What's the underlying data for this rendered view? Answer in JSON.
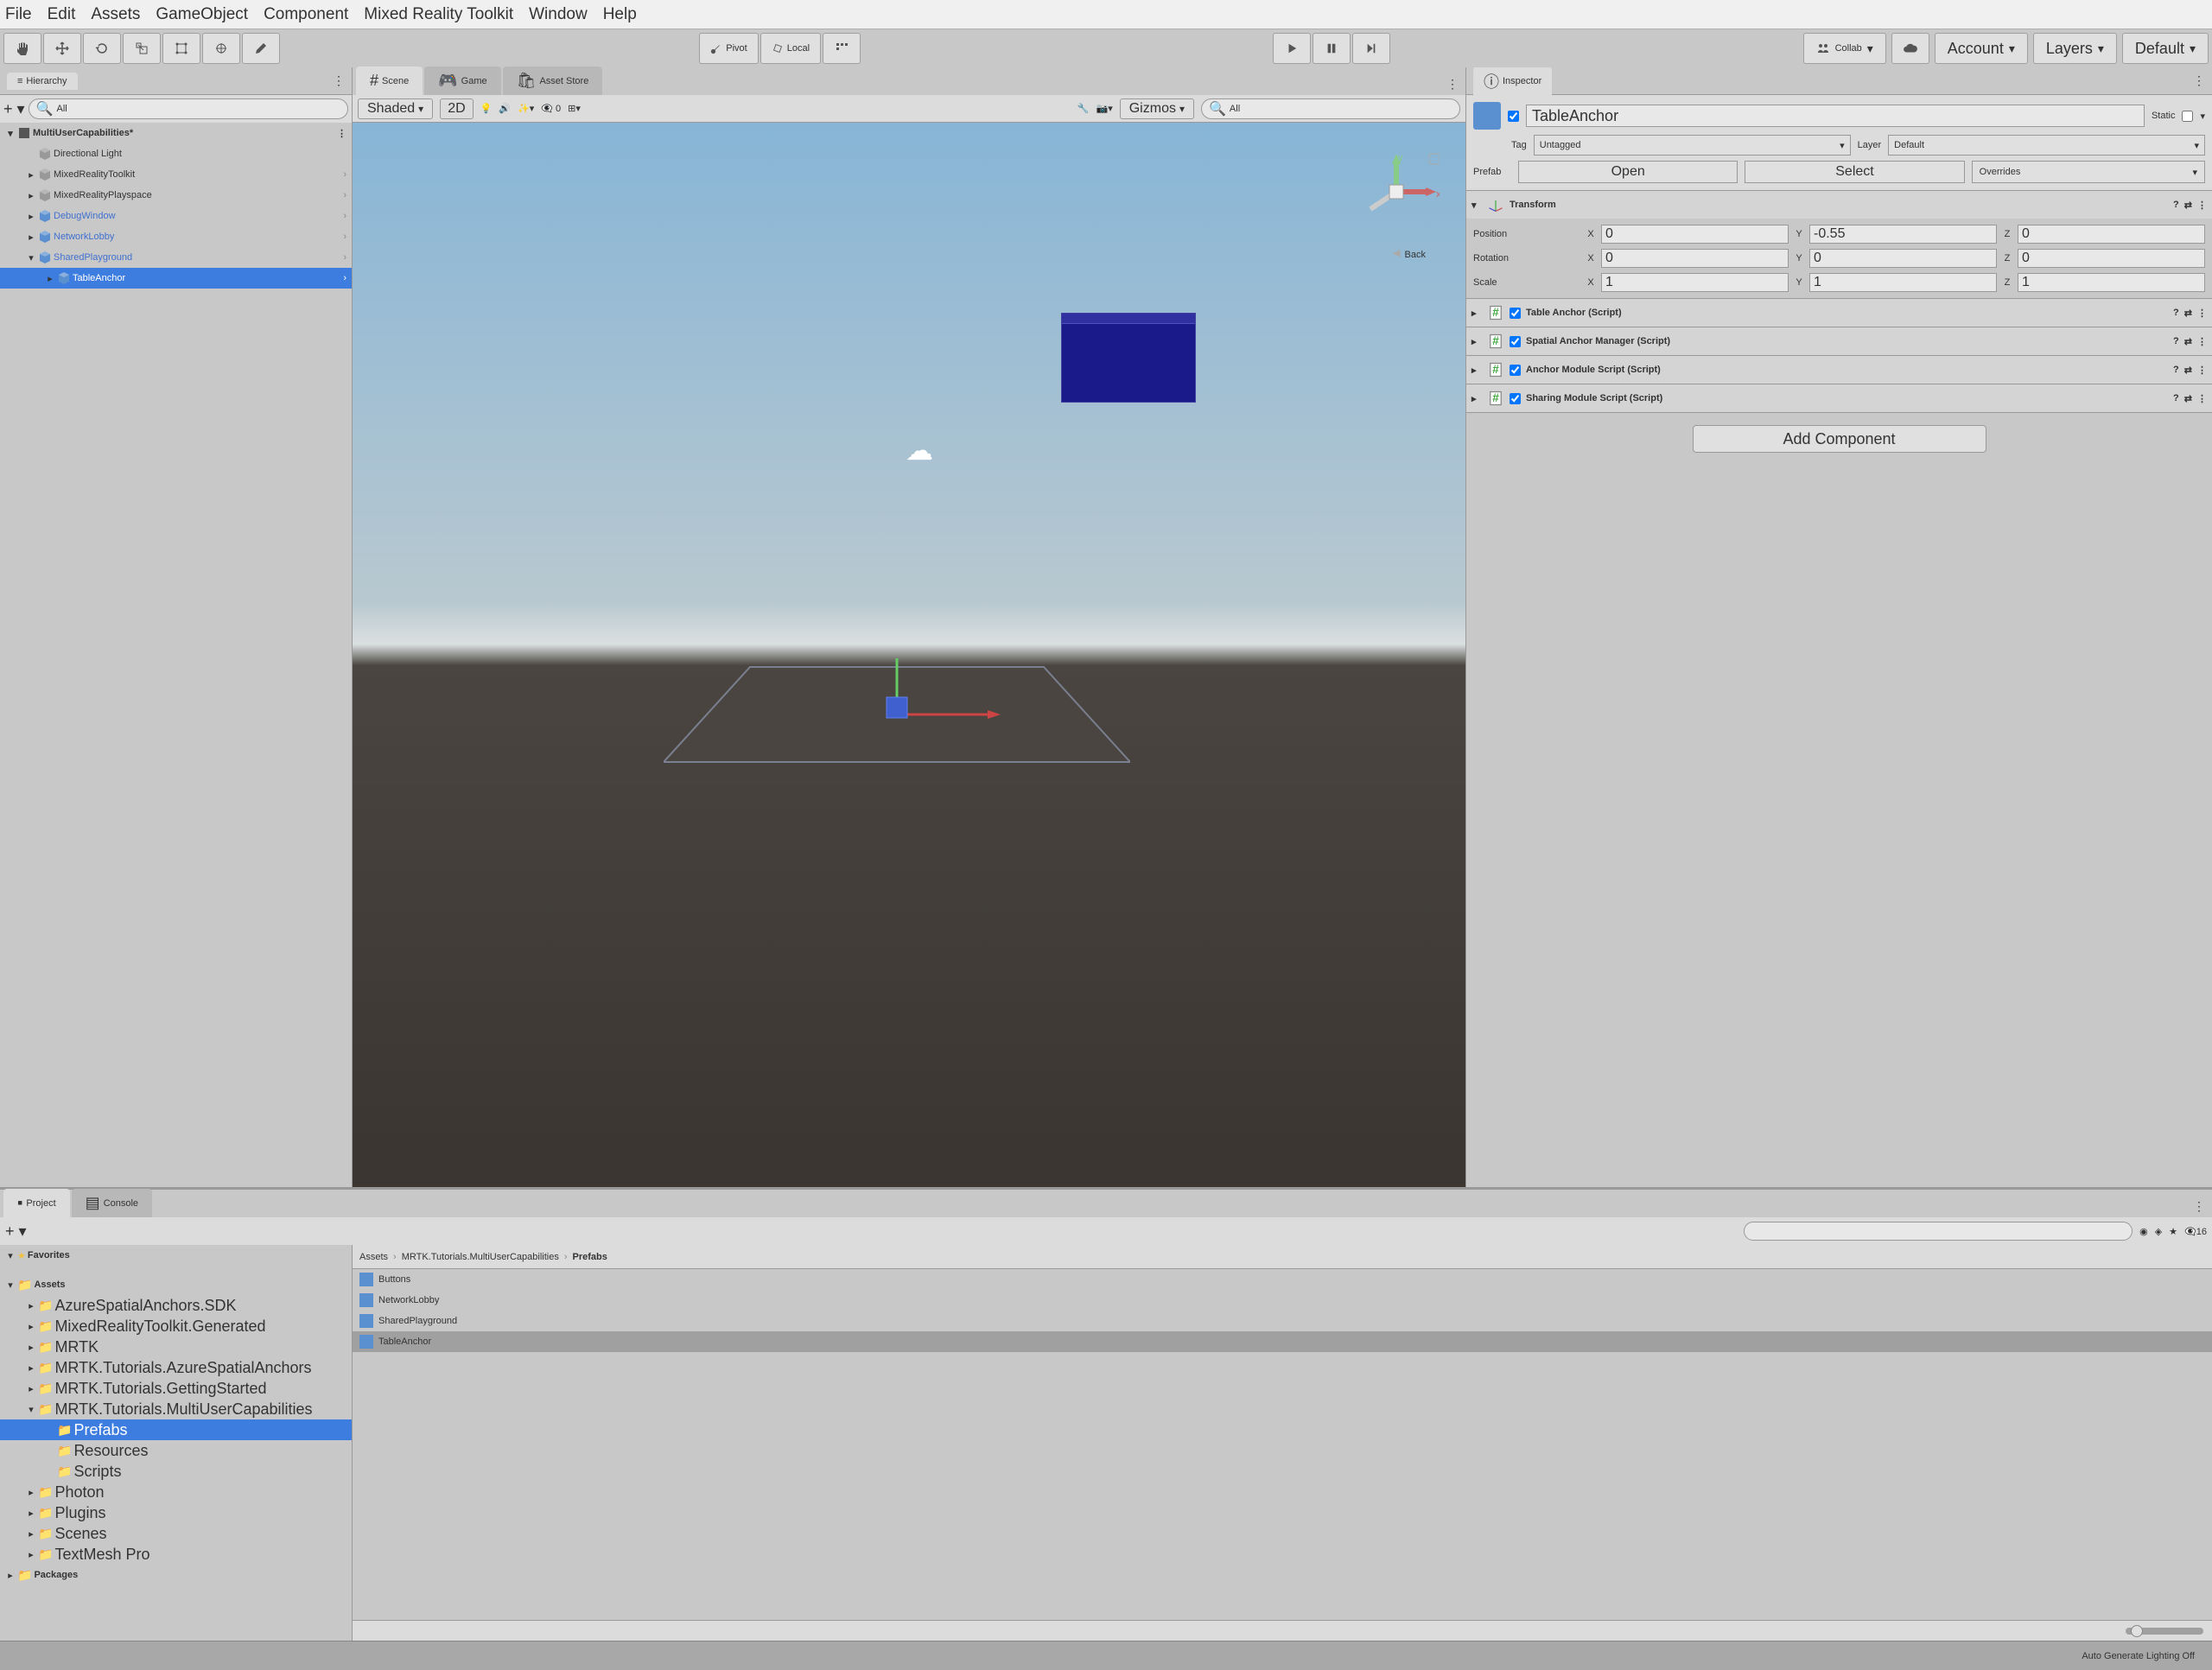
{
  "menubar": [
    "File",
    "Edit",
    "Assets",
    "GameObject",
    "Component",
    "Mixed Reality Toolkit",
    "Window",
    "Help"
  ],
  "toolbar": {
    "pivot": "Pivot",
    "local": "Local",
    "collab": "Collab",
    "account": "Account",
    "layers": "Layers",
    "layout": "Default"
  },
  "hierarchy": {
    "title": "Hierarchy",
    "search_placeholder": "All",
    "root": "MultiUserCapabilities*",
    "items": [
      {
        "name": "Directional Light",
        "depth": 1,
        "type": "light",
        "fold": ""
      },
      {
        "name": "MixedRealityToolkit",
        "depth": 1,
        "type": "prefab",
        "fold": "▸"
      },
      {
        "name": "MixedRealityPlayspace",
        "depth": 1,
        "type": "prefab",
        "fold": "▸"
      },
      {
        "name": "DebugWindow",
        "depth": 1,
        "type": "prefab",
        "fold": "▸",
        "blue": true
      },
      {
        "name": "NetworkLobby",
        "depth": 1,
        "type": "prefab",
        "fold": "▸",
        "blue": true
      },
      {
        "name": "SharedPlayground",
        "depth": 1,
        "type": "prefab",
        "fold": "▾",
        "blue": true
      },
      {
        "name": "TableAnchor",
        "depth": 2,
        "type": "prefab",
        "fold": "▸",
        "blue": true,
        "selected": true
      }
    ]
  },
  "center": {
    "tabs": [
      "Scene",
      "Game",
      "Asset Store"
    ],
    "shaded": "Shaded",
    "mode2d": "2D",
    "gizmos": "Gizmos",
    "zero": "0",
    "back": "Back",
    "search_placeholder": "All"
  },
  "inspector": {
    "title": "Inspector",
    "name": "TableAnchor",
    "static": "Static",
    "tag_label": "Tag",
    "tag_value": "Untagged",
    "layer_label": "Layer",
    "layer_value": "Default",
    "prefab_label": "Prefab",
    "open": "Open",
    "select": "Select",
    "overrides": "Overrides",
    "transform": {
      "title": "Transform",
      "rows": [
        {
          "label": "Position",
          "x": "0",
          "y": "-0.55",
          "z": "0"
        },
        {
          "label": "Rotation",
          "x": "0",
          "y": "0",
          "z": "0"
        },
        {
          "label": "Scale",
          "x": "1",
          "y": "1",
          "z": "1"
        }
      ]
    },
    "scripts": [
      "Table Anchor (Script)",
      "Spatial Anchor Manager (Script)",
      "Anchor Module Script (Script)",
      "Sharing Module Script (Script)"
    ],
    "add_component": "Add Component"
  },
  "project": {
    "title": "Project",
    "console": "Console",
    "count": "16",
    "favorites": "Favorites",
    "assets": "Assets",
    "packages": "Packages",
    "tree": [
      {
        "name": "AzureSpatialAnchors.SDK",
        "depth": 1,
        "fold": "▸"
      },
      {
        "name": "MixedRealityToolkit.Generated",
        "depth": 1,
        "fold": "▸"
      },
      {
        "name": "MRTK",
        "depth": 1,
        "fold": "▸"
      },
      {
        "name": "MRTK.Tutorials.AzureSpatialAnchors",
        "depth": 1,
        "fold": "▸"
      },
      {
        "name": "MRTK.Tutorials.GettingStarted",
        "depth": 1,
        "fold": "▸"
      },
      {
        "name": "MRTK.Tutorials.MultiUserCapabilities",
        "depth": 1,
        "fold": "▾"
      },
      {
        "name": "Prefabs",
        "depth": 2,
        "fold": "",
        "selected": true
      },
      {
        "name": "Resources",
        "depth": 2,
        "fold": ""
      },
      {
        "name": "Scripts",
        "depth": 2,
        "fold": ""
      },
      {
        "name": "Photon",
        "depth": 1,
        "fold": "▸"
      },
      {
        "name": "Plugins",
        "depth": 1,
        "fold": "▸"
      },
      {
        "name": "Scenes",
        "depth": 1,
        "fold": "▸"
      },
      {
        "name": "TextMesh Pro",
        "depth": 1,
        "fold": "▸"
      }
    ],
    "breadcrumb": [
      "Assets",
      "MRTK.Tutorials.MultiUserCapabilities",
      "Prefabs"
    ],
    "items": [
      {
        "name": "Buttons"
      },
      {
        "name": "NetworkLobby"
      },
      {
        "name": "SharedPlayground"
      },
      {
        "name": "TableAnchor",
        "selected": true
      }
    ]
  },
  "statusbar": "Auto Generate Lighting Off"
}
